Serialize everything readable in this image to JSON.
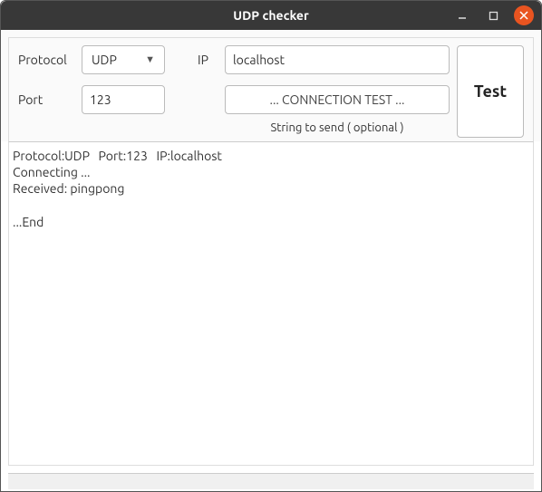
{
  "window": {
    "title": "UDP checker"
  },
  "form": {
    "protocol_label": "Protocol",
    "protocol_value": "UDP",
    "ip_label": "IP",
    "ip_value": "localhost",
    "port_label": "Port",
    "port_value": "123",
    "send_value": "... CONNECTION TEST ...",
    "send_hint": "String to send ( optional )",
    "test_label": "Test"
  },
  "output": "Protocol:UDP   Port:123   IP:localhost\nConnecting ...\nReceived: pingpong\n\n...End"
}
